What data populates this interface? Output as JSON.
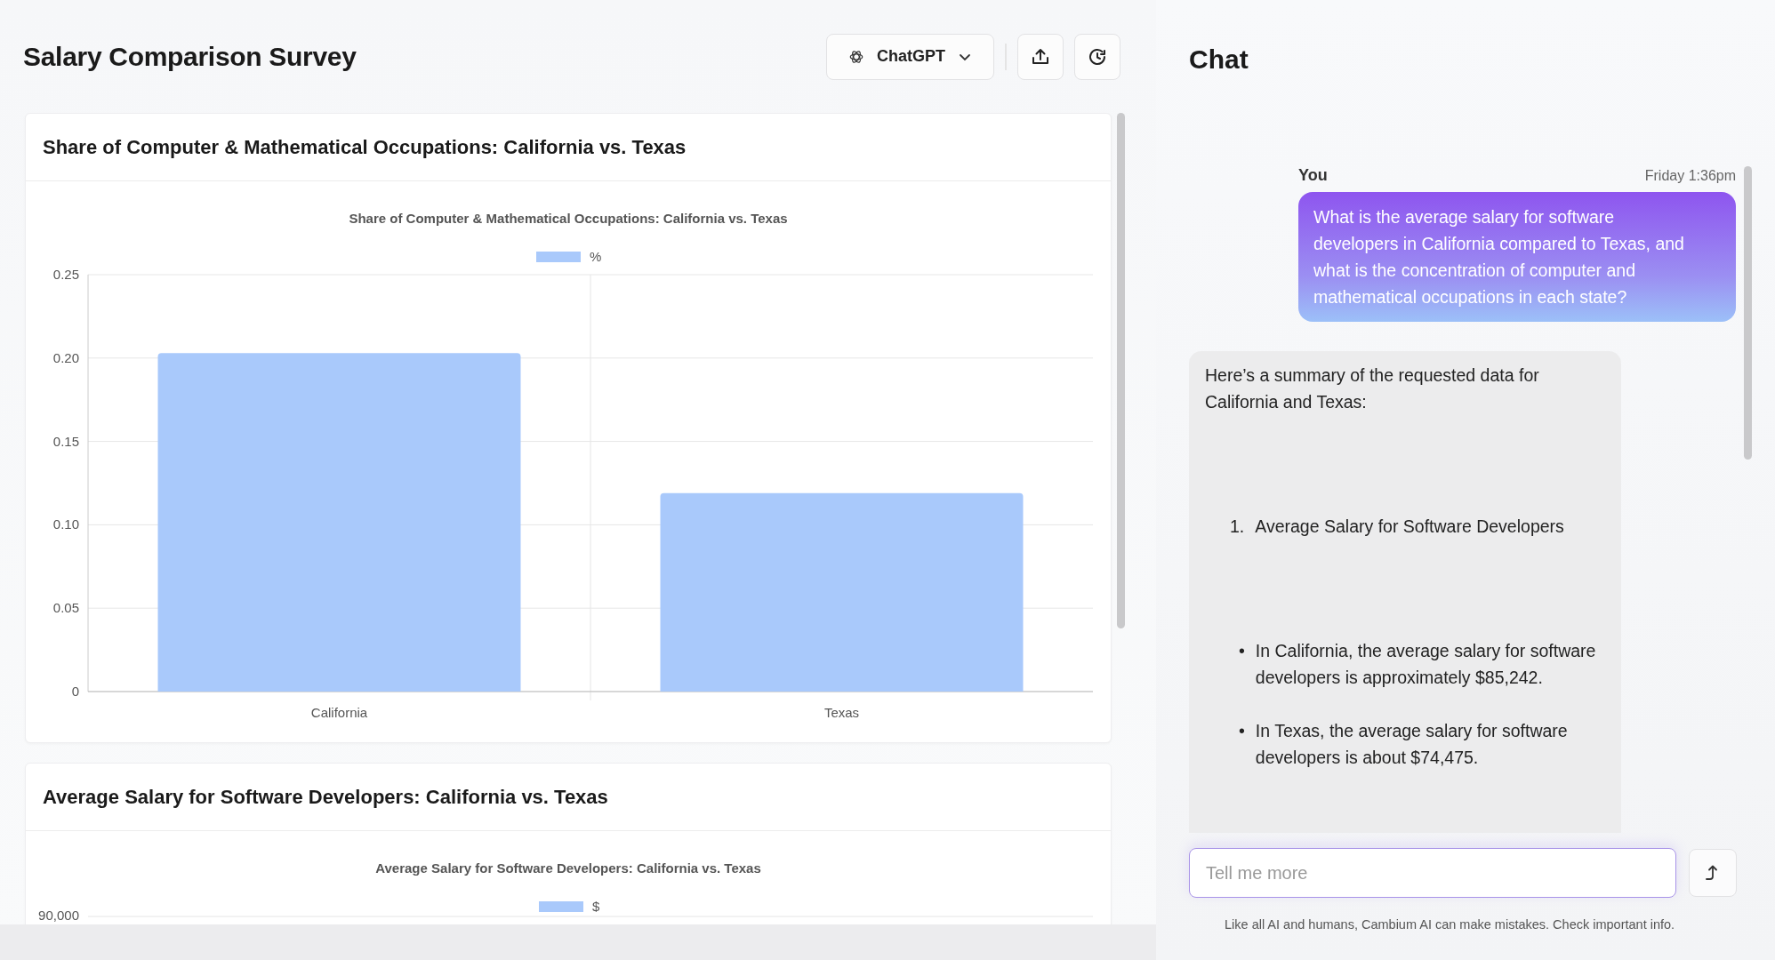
{
  "header": {
    "title": "Salary Comparison Survey",
    "model_button": "ChatGPT"
  },
  "cards": [
    {
      "title": "Share of Computer & Mathematical Occupations: California vs. Texas",
      "chart_data": {
        "type": "bar",
        "title": "Share of Computer & Mathematical Occupations: California vs. Texas",
        "categories": [
          "California",
          "Texas"
        ],
        "series": [
          {
            "name": "%",
            "color": "#a9c9fb",
            "values": [
              0.203,
              0.119
            ]
          }
        ],
        "ylim": [
          0,
          0.25
        ],
        "grid": true,
        "yticks": [
          {
            "value": 0,
            "label": "0"
          },
          {
            "value": 0.05,
            "label": "0.05"
          },
          {
            "value": 0.1,
            "label": "0.10"
          },
          {
            "value": 0.15,
            "label": "0.15"
          },
          {
            "value": 0.2,
            "label": "0.20"
          },
          {
            "value": 0.25,
            "label": "0.25"
          }
        ]
      }
    },
    {
      "title": "Average Salary for Software Developers: California vs. Texas",
      "chart_title": "Average Salary for Software Developers: California vs. Texas",
      "legend": {
        "name": "$",
        "color": "#a9c9fb"
      },
      "top_tick": "90,000"
    }
  ],
  "chat": {
    "title": "Chat",
    "messages": [
      {
        "kind": "user",
        "author": "You",
        "time": "Friday 1:36pm",
        "text": "What is the average salary for software developers in California compared to Texas, and what is the concentration of computer and mathematical occupations in each state?"
      },
      {
        "kind": "assistant",
        "blocks": [
          {
            "kind": "paragraph",
            "text": "Here’s a summary of the requested data for California and Texas:"
          },
          {
            "kind": "numbered",
            "marker": "1.",
            "text": "Average Salary for Software Developers"
          },
          {
            "kind": "bullet",
            "marker": "•",
            "text": "In California, the average salary for software developers is approximately $85,242."
          },
          {
            "kind": "bullet",
            "marker": "•",
            "text": "In Texas, the average salary for software developers is about $74,475."
          }
        ]
      }
    ],
    "input": {
      "placeholder": "Tell me more"
    },
    "disclaimer": "Like all AI and humans, Cambium AI can make mistakes. Check important info."
  }
}
